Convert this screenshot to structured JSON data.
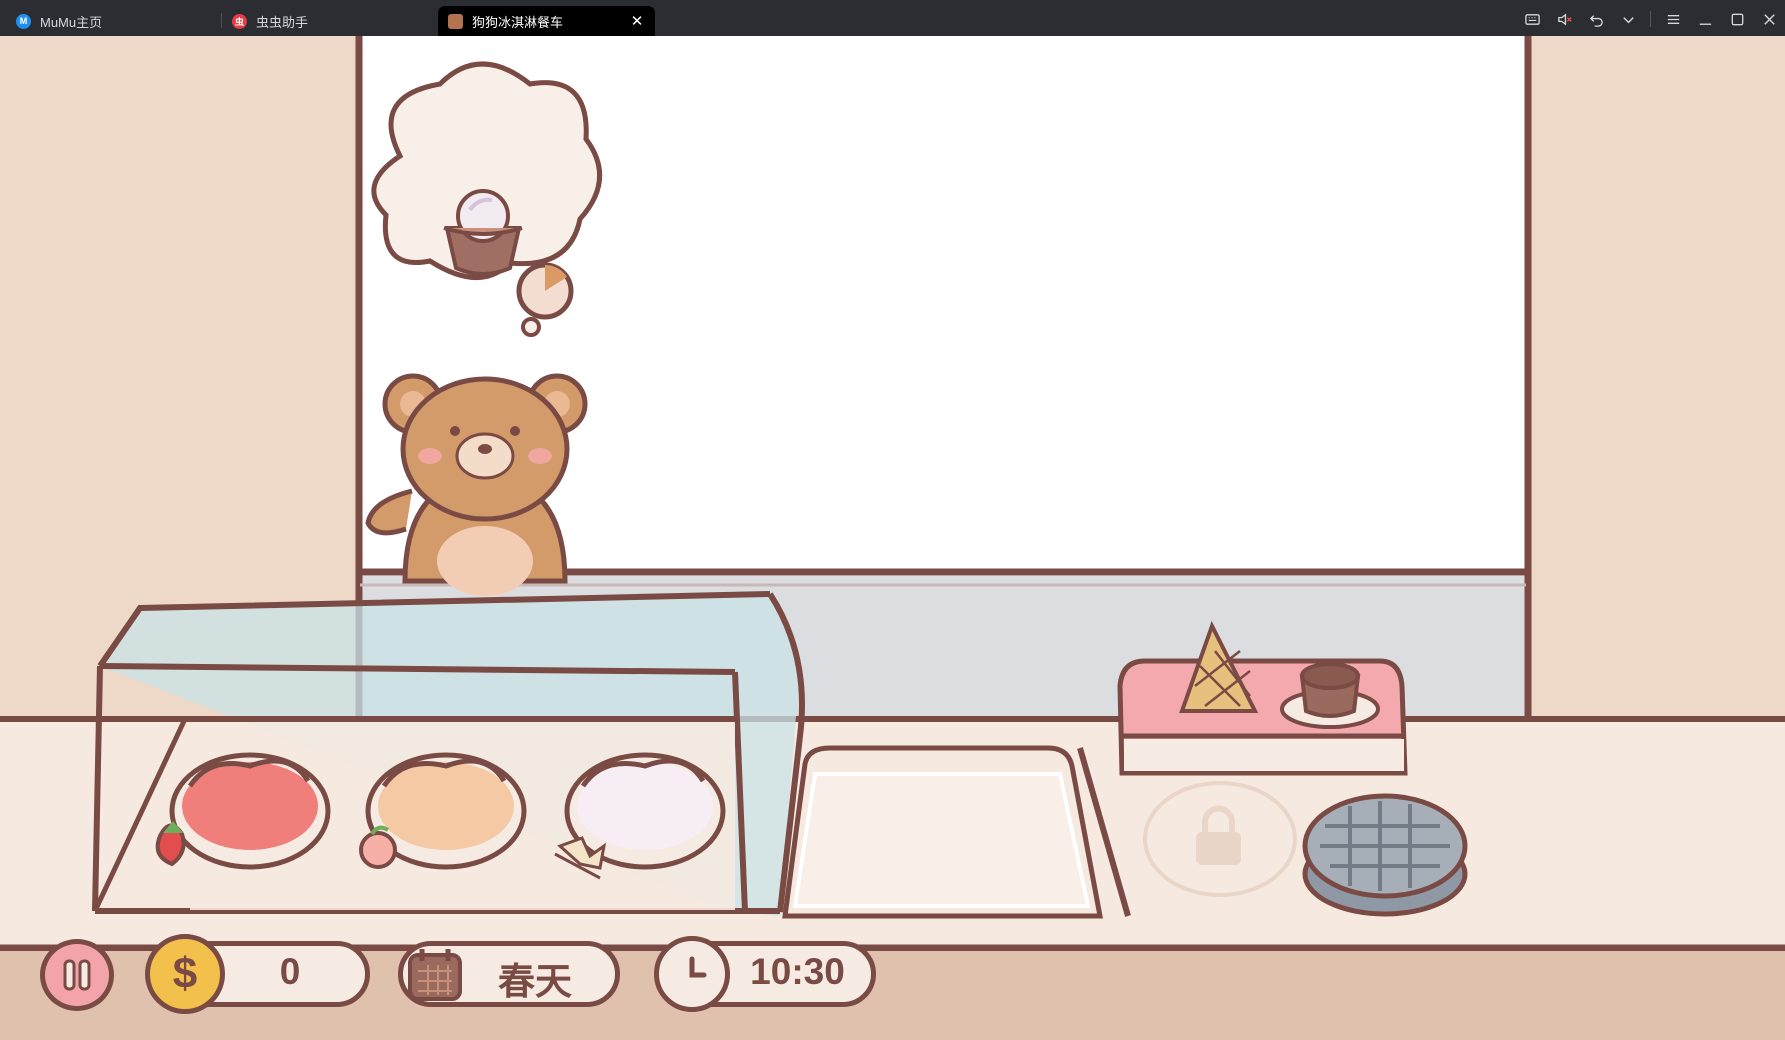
{
  "tabs": [
    {
      "label": "MuMu主页",
      "icon": "mumu-icon"
    },
    {
      "label": "虫虫助手",
      "icon": "chongchong-icon"
    },
    {
      "label": "狗狗冰淇淋餐车",
      "icon": "game-icon"
    }
  ],
  "window_controls": [
    "keyboard-icon",
    "mute-icon",
    "back-icon",
    "chevron-down-icon",
    "menu-icon",
    "minimize-icon",
    "maximize-icon",
    "close-icon"
  ],
  "hud": {
    "coins": "0",
    "season": "春天",
    "time": "10:30"
  },
  "order": {
    "item": "ice-cream-cup",
    "timer_fraction": 0.2
  },
  "toppings": [
    "strawberry",
    "peach",
    "flower"
  ],
  "colors": {
    "outline": "#7a4a44",
    "wall": "#eed8c8",
    "hud_bg": "#dfc1ad"
  }
}
